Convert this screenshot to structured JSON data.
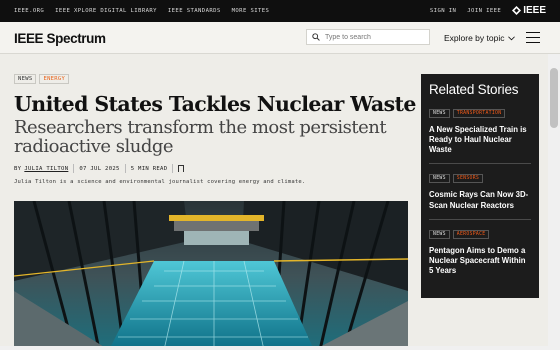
{
  "topbar": {
    "links": [
      "IEEE.ORG",
      "IEEE XPLORE DIGITAL LIBRARY",
      "IEEE STANDARDS",
      "MORE SITES"
    ],
    "sign_in": "SIGN IN",
    "join": "JOIN IEEE",
    "logo": "IEEE"
  },
  "header": {
    "brand_a": "IEEE",
    "brand_b": "Spectrum",
    "search_placeholder": "Type to search",
    "explore_label": "Explore by topic"
  },
  "article": {
    "tags": [
      "NEWS",
      "ENERGY"
    ],
    "title": "United States Tackles Nuclear Waste",
    "subtitle": "Researchers transform the most persistent radioactive sludge",
    "by": "BY",
    "author": "JULIA TILTON",
    "date": "07 JUL 2025",
    "read_time": "5 MIN READ",
    "bio": "Julia Tilton is a science and environmental journalist covering energy and climate."
  },
  "related": {
    "heading": "Related Stories",
    "stories": [
      {
        "tag1": "NEWS",
        "tag2": "TRANSPORTATION",
        "title": "A New Specialized Train is Ready to Haul Nuclear Waste"
      },
      {
        "tag1": "NEWS",
        "tag2": "SENSORS",
        "title": "Cosmic Rays Can Now 3D-Scan Nuclear Reactors"
      },
      {
        "tag1": "NEWS",
        "tag2": "AEROSPACE",
        "title": "Pentagon Aims to Demo a Nuclear Spacecraft Within 5 Years"
      }
    ]
  },
  "colors": {
    "accent": "#e8641b",
    "topbar_bg": "#0f0f0f",
    "sidebar_bg": "#1c1c1c",
    "page_bg": "#eeede8"
  },
  "icons": {
    "search": "search-icon",
    "chevron": "chevron-down-icon",
    "menu": "hamburger-menu-icon",
    "bookmark": "bookmark-icon",
    "title_arrow": "chevron-right-icon"
  }
}
